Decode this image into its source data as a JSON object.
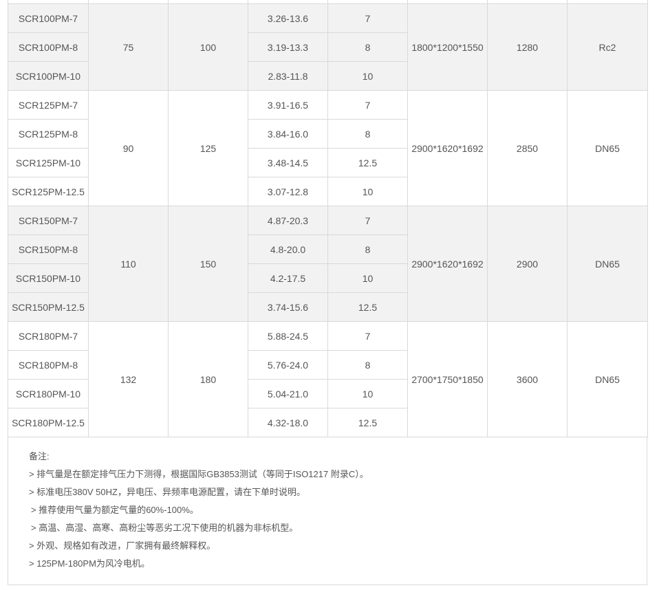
{
  "groups": [
    {
      "power_kw": "75",
      "power_hp": "100",
      "dimensions": "1800*1200*1550",
      "weight": "1280",
      "outlet": "Rc2",
      "rows": [
        {
          "model": "SCR100PM-7",
          "flow": "3.26-13.6",
          "pressure": "7"
        },
        {
          "model": "SCR100PM-8",
          "flow": "3.19-13.3",
          "pressure": "8"
        },
        {
          "model": "SCR100PM-10",
          "flow": "2.83-11.8",
          "pressure": "10"
        }
      ]
    },
    {
      "power_kw": "90",
      "power_hp": "125",
      "dimensions": "2900*1620*1692",
      "weight": "2850",
      "outlet": "DN65",
      "rows": [
        {
          "model": "SCR125PM-7",
          "flow": "3.91-16.5",
          "pressure": "7"
        },
        {
          "model": "SCR125PM-8",
          "flow": "3.84-16.0",
          "pressure": "8"
        },
        {
          "model": "SCR125PM-10",
          "flow": "3.48-14.5",
          "pressure": "12.5"
        },
        {
          "model": "SCR125PM-12.5",
          "flow": "3.07-12.8",
          "pressure": "10"
        }
      ]
    },
    {
      "power_kw": "110",
      "power_hp": "150",
      "dimensions": "2900*1620*1692",
      "weight": "2900",
      "outlet": "DN65",
      "rows": [
        {
          "model": "SCR150PM-7",
          "flow": "4.87-20.3",
          "pressure": "7"
        },
        {
          "model": "SCR150PM-8",
          "flow": "4.8-20.0",
          "pressure": "8"
        },
        {
          "model": "SCR150PM-10",
          "flow": "4.2-17.5",
          "pressure": "10"
        },
        {
          "model": "SCR150PM-12.5",
          "flow": "3.74-15.6",
          "pressure": "12.5"
        }
      ]
    },
    {
      "power_kw": "132",
      "power_hp": "180",
      "dimensions": "2700*1750*1850",
      "weight": "3600",
      "outlet": "DN65",
      "rows": [
        {
          "model": "SCR180PM-7",
          "flow": "5.88-24.5",
          "pressure": "7"
        },
        {
          "model": "SCR180PM-8",
          "flow": "5.76-24.0",
          "pressure": "8"
        },
        {
          "model": "SCR180PM-10",
          "flow": "5.04-21.0",
          "pressure": "10"
        },
        {
          "model": "SCR180PM-12.5",
          "flow": "4.32-18.0",
          "pressure": "12.5"
        }
      ]
    }
  ],
  "notes": {
    "title": "备注:",
    "lines": [
      "> 排气量是在额定排气压力下测得，根据国际GB3853测试（等同于ISO1217 附录C）。",
      "> 标准电压380V 50HZ，异电压、异频率电源配置，请在下单时说明。",
      " > 推荐使用气量为额定气量的60%-100%。",
      " > 高温、高湿、高寒、高粉尘等恶劣工况下使用的机器为非标机型。",
      "> 外观、规格如有改进，厂家拥有最终解释权。",
      "> 125PM-180PM为风冷电机。"
    ]
  },
  "colors": {
    "shaded_row": "#f2f2f2",
    "border": "#d9d9d9",
    "text": "#555555"
  }
}
